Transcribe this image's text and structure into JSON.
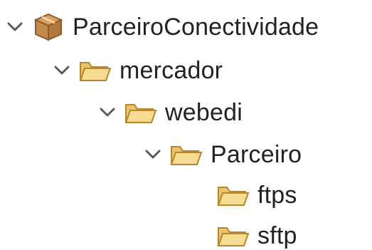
{
  "tree": {
    "project": {
      "label": "ParceiroConectividade",
      "icon": "project-icon",
      "expanded": true
    },
    "nodes": [
      {
        "label": "mercador",
        "icon": "folder-open-icon",
        "expanded": true
      },
      {
        "label": "webedi",
        "icon": "folder-open-icon",
        "expanded": true
      },
      {
        "label": "Parceiro",
        "icon": "folder-open-icon",
        "expanded": true
      },
      {
        "label": "ftps",
        "icon": "folder-open-icon",
        "expanded": false
      },
      {
        "label": "sftp",
        "icon": "folder-open-icon",
        "expanded": false
      }
    ]
  },
  "colors": {
    "text": "#222222",
    "chevron": "#5a5a5a",
    "folder_light": "#f6dc92",
    "folder_dark": "#d8a746",
    "folder_stroke": "#b8862c",
    "project_box": "#c48a4a",
    "project_box_dark": "#8f5b2e"
  }
}
